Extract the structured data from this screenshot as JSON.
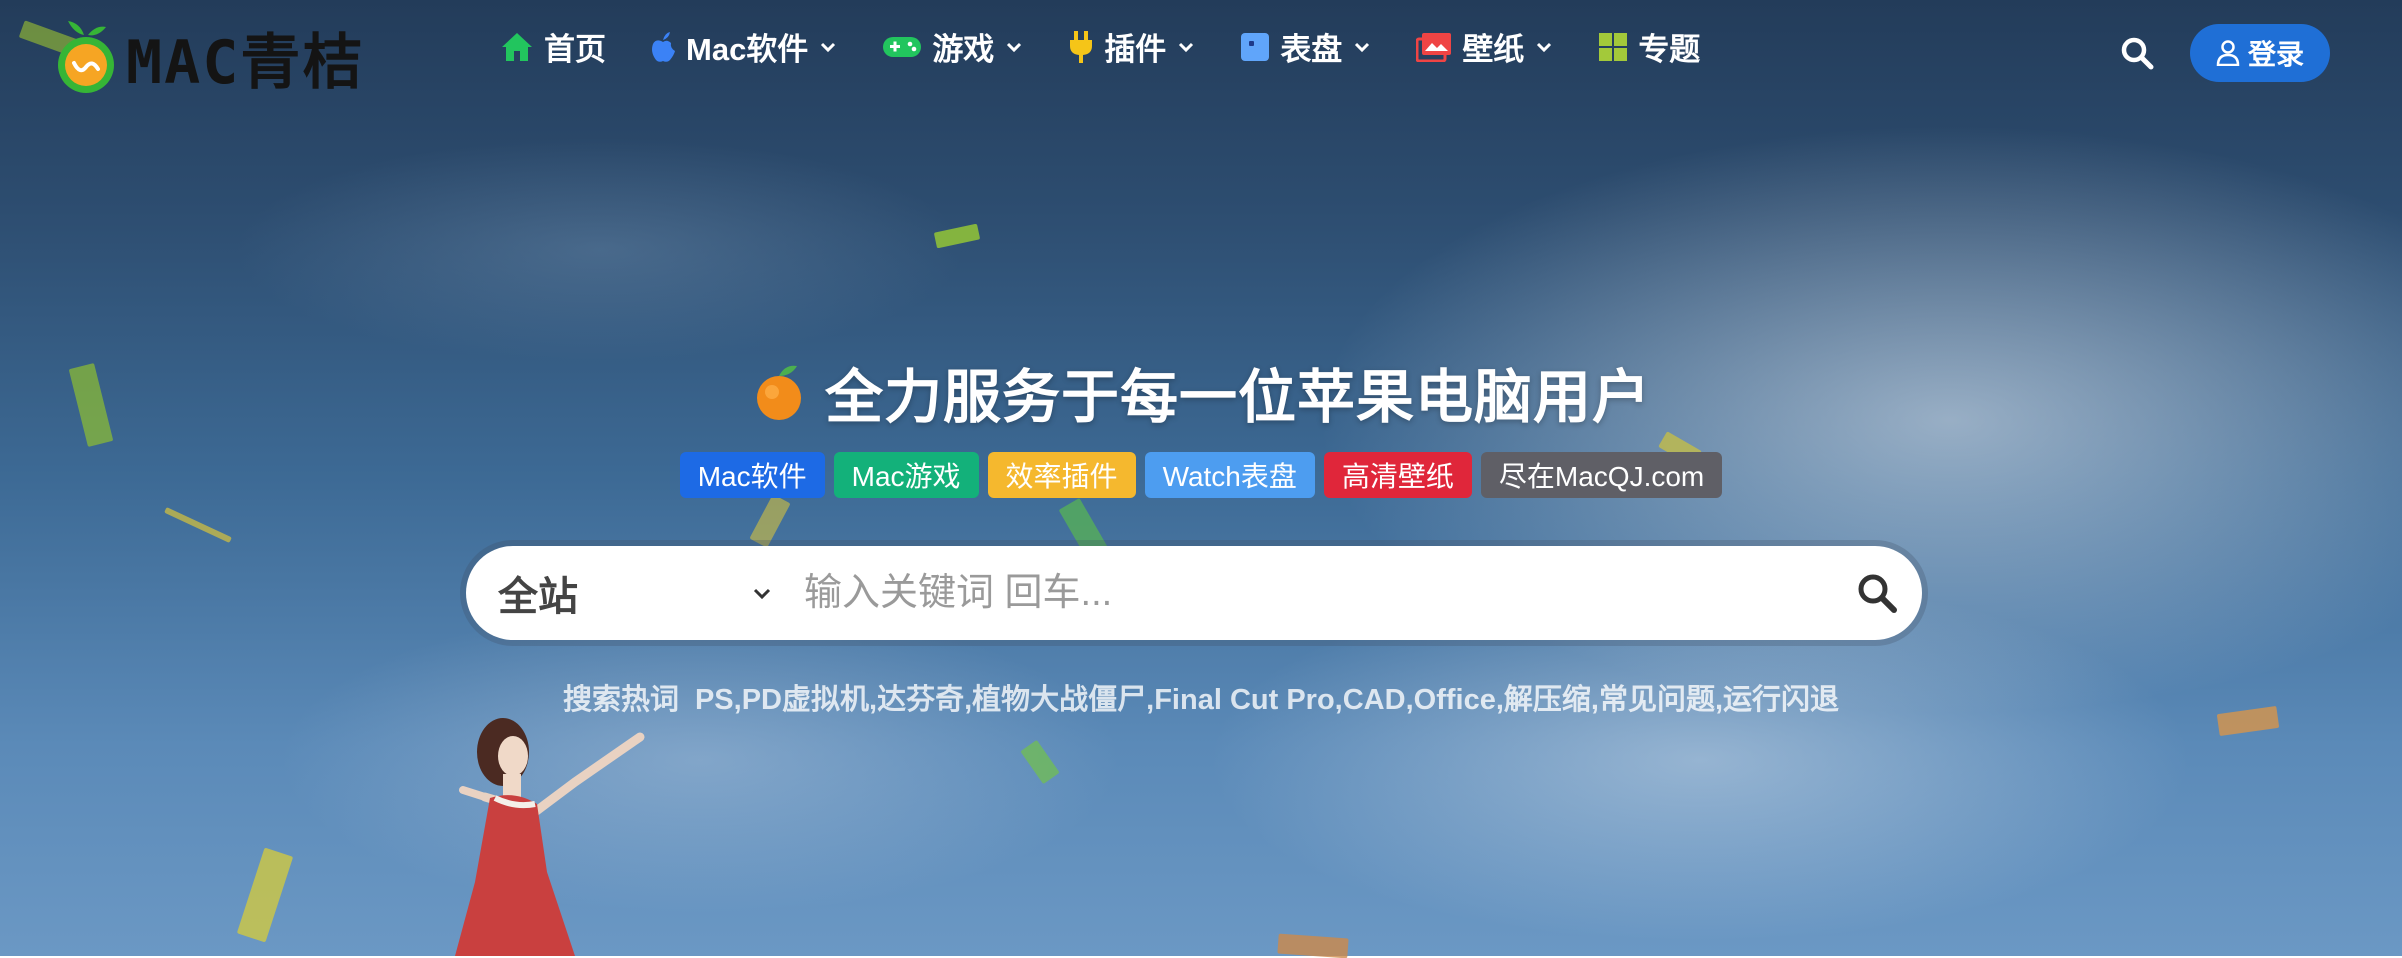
{
  "header": {
    "logo_text": "MAC青桔",
    "nav": [
      {
        "label": "首页",
        "icon": "home-icon",
        "dropdown": false,
        "color": "#22c55e"
      },
      {
        "label": "Mac软件",
        "icon": "apple-icon",
        "dropdown": true,
        "color": "#3b82f6"
      },
      {
        "label": "游戏",
        "icon": "gamepad-icon",
        "dropdown": true,
        "color": "#22c55e"
      },
      {
        "label": "插件",
        "icon": "plug-icon",
        "dropdown": true,
        "color": "#f5c518"
      },
      {
        "label": "表盘",
        "icon": "watch-face-icon",
        "dropdown": true,
        "color": "#60a5fa"
      },
      {
        "label": "壁纸",
        "icon": "wallpaper-icon",
        "dropdown": true,
        "color": "#ef4444"
      },
      {
        "label": "专题",
        "icon": "grid-icon",
        "dropdown": false,
        "color": "#a3c93a"
      }
    ],
    "login_label": "登录"
  },
  "hero": {
    "title": "全力服务于每一位苹果电脑用户",
    "title_icon": "tangerine-icon",
    "tags": [
      {
        "label": "Mac软件",
        "color": "#1d6ae5"
      },
      {
        "label": "Mac游戏",
        "color": "#13b17a"
      },
      {
        "label": "效率插件",
        "color": "#f5b82e"
      },
      {
        "label": "Watch表盘",
        "color": "#4d9df0"
      },
      {
        "label": "高清壁纸",
        "color": "#e0263a"
      },
      {
        "label": "尽在MacQJ.com",
        "color": "#5f5f66"
      }
    ]
  },
  "search": {
    "scope": "全站",
    "placeholder": "输入关键词 回车...",
    "value": ""
  },
  "hot": {
    "label": "搜索热词",
    "keywords": [
      "PS",
      "PD虚拟机",
      "达芬奇",
      "植物大战僵尸",
      "Final Cut Pro",
      "CAD",
      "Office",
      "解压缩",
      "常见问题",
      "运行闪退"
    ]
  }
}
